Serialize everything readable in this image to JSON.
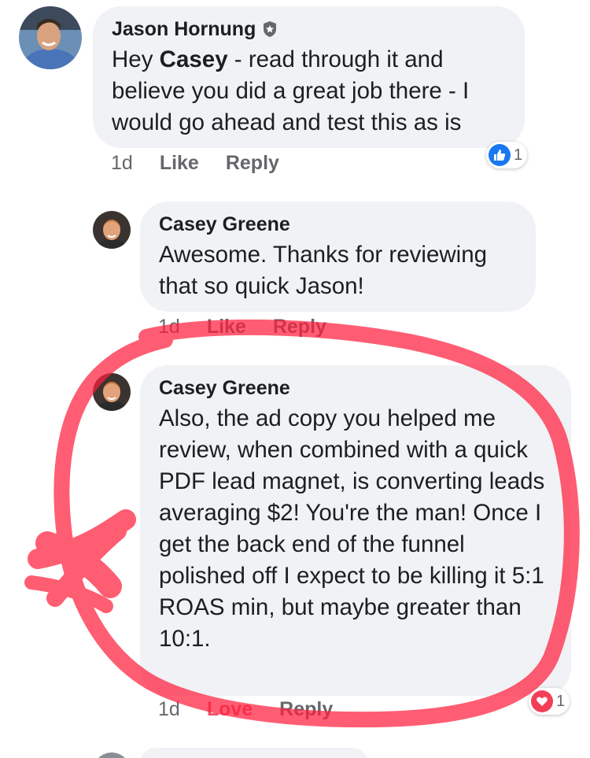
{
  "comments": [
    {
      "author": "Jason Hornung",
      "text_pre": "Hey ",
      "text_bold": "Casey",
      "text_post": " - read through it and believe you did a great job there - I would go ahead and test this as is",
      "time": "1d",
      "like_label": "Like",
      "reply_label": "Reply",
      "reaction_count": "1",
      "reaction_icon": "thumbs-up-icon",
      "reaction_color": "#1877f2"
    },
    {
      "author": "Casey Greene",
      "text": "Awesome. Thanks for reviewing that so quick Jason!",
      "time": "1d",
      "like_label": "Like",
      "reply_label": "Reply"
    },
    {
      "author": "Casey Greene",
      "text": "Also, the ad copy you helped me review, when combined with a quick PDF lead magnet, is converting leads averaging $2! You're the man! Once I get the back end of the funnel polished off I expect to be killing it 5:1 ROAS min, but maybe greater than 10:1.",
      "time": "1d",
      "love_label": "Love",
      "reply_label": "Reply",
      "reaction_count": "1",
      "reaction_icon": "heart-icon",
      "reaction_color": "#f33e58"
    }
  ],
  "colors": {
    "bubble": "#f0f2f5",
    "meta_text": "#65676b",
    "love": "#f25268",
    "annotation": "#ff1f3d"
  },
  "icons": {
    "badge": "admin-shield-icon"
  }
}
